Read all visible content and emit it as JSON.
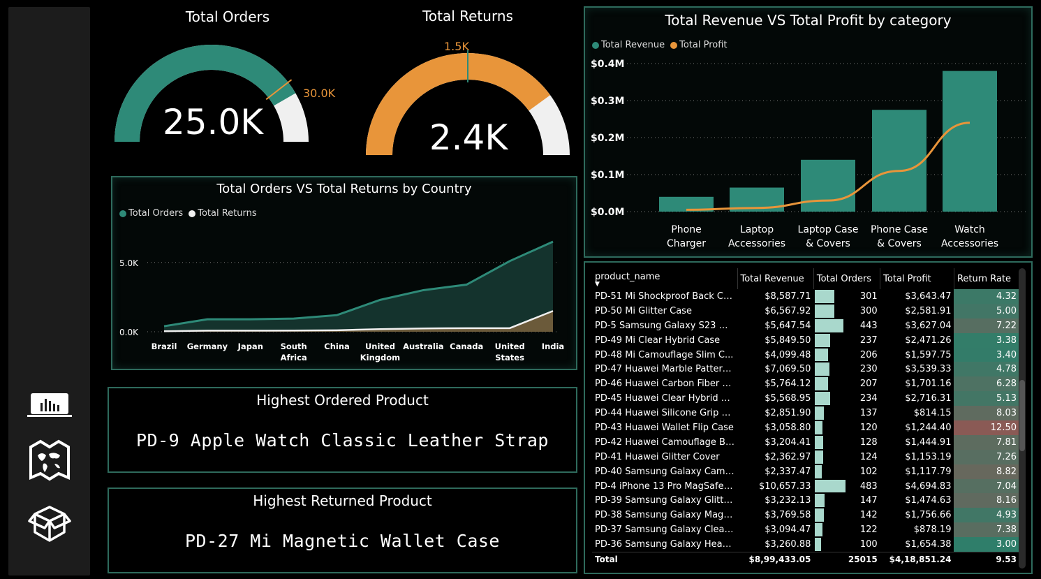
{
  "gauges": {
    "orders": {
      "title": "Total Orders",
      "value": "25.0K",
      "max_label": "30.0K",
      "fraction": 0.833
    },
    "returns": {
      "title": "Total Returns",
      "value": "2.4K",
      "target_label": "1.5K",
      "fraction": 0.8
    }
  },
  "country_chart": {
    "title": "Total Orders VS Total Returns by Country",
    "legend": [
      "Total Orders",
      "Total Returns"
    ]
  },
  "category_chart": {
    "title": "Total Revenue VS Total Profit by category",
    "legend": [
      "Total Revenue",
      "Total Profit"
    ]
  },
  "cards": {
    "highest_ordered": {
      "title": "Highest Ordered Product",
      "value": "PD-9  Apple Watch Classic Leather Strap"
    },
    "highest_returned": {
      "title": "Highest Returned Product",
      "value": "PD-27  Mi Magnetic Wallet Case"
    }
  },
  "table": {
    "headers": [
      "product_name",
      "Total Revenue",
      "Total Orders",
      "Total Profit",
      "Return Rate"
    ],
    "rows": [
      [
        "PD-51  Mi Shockproof Back Ca...",
        "$8,587.71",
        "301",
        "$3,643.47",
        "4.32"
      ],
      [
        "PD-50  Mi Glitter Case",
        "$6,567.92",
        "300",
        "$2,581.91",
        "5.00"
      ],
      [
        "PD-5  Samsung Galaxy S23 Ma...",
        "$5,647.54",
        "443",
        "$3,627.04",
        "7.22"
      ],
      [
        "PD-49  Mi Clear Hybrid Case",
        "$5,849.50",
        "237",
        "$2,471.26",
        "3.38"
      ],
      [
        "PD-48  Mi Camouflage Slim C...",
        "$4,099.48",
        "206",
        "$1,597.75",
        "3.40"
      ],
      [
        "PD-47  Huawei Marble Pattern...",
        "$7,069.50",
        "230",
        "$3,539.33",
        "4.78"
      ],
      [
        "PD-46  Huawei Carbon Fiber C...",
        "$5,764.12",
        "207",
        "$1,701.16",
        "6.28"
      ],
      [
        "PD-45  Huawei Clear Hybrid C...",
        "$5,568.95",
        "234",
        "$2,716.31",
        "5.13"
      ],
      [
        "PD-44  Huawei Silicone Grip C...",
        "$2,851.90",
        "137",
        "$814.15",
        "8.03"
      ],
      [
        "PD-43  Huawei Wallet Flip Case",
        "$3,058.80",
        "120",
        "$1,244.40",
        "12.50"
      ],
      [
        "PD-42  Huawei Camouflage Ba...",
        "$3,204.41",
        "128",
        "$1,444.91",
        "7.81"
      ],
      [
        "PD-41  Huawei Glitter Cover",
        "$2,362.97",
        "124",
        "$1,153.19",
        "7.26"
      ],
      [
        "PD-40  Samsung Galaxy Camo...",
        "$2,337.47",
        "102",
        "$1,117.79",
        "8.82"
      ],
      [
        "PD-4  iPhone 13 Pro MagSafe ...",
        "$10,657.33",
        "483",
        "$4,694.83",
        "7.04"
      ],
      [
        "PD-39  Samsung Galaxy Glitter...",
        "$3,232.13",
        "147",
        "$1,474.63",
        "8.16"
      ],
      [
        "PD-38  Samsung Galaxy Magn...",
        "$3,769.58",
        "142",
        "$1,756.66",
        "4.93"
      ],
      [
        "PD-37  Samsung Galaxy Clear ...",
        "$3,094.47",
        "122",
        "$878.19",
        "7.38"
      ],
      [
        "PD-36  Samsung Galaxy Heavy...",
        "$3,260.88",
        "100",
        "$1,654.38",
        "3.00"
      ]
    ],
    "total": [
      "Total",
      "$8,99,433.05",
      "25015",
      "$4,18,851.24",
      "9.53"
    ]
  },
  "colors": {
    "teal": "#2e8a78",
    "orange": "#e8953a",
    "light": "#f0f0f0",
    "rate_low": "#2f7e6a",
    "rate_high": "#8a5a55"
  },
  "chart_data": [
    {
      "type": "area",
      "title": "Total Orders VS Total Returns by Country",
      "categories": [
        "Brazil",
        "Germany",
        "Japan",
        "South Africa",
        "China",
        "United Kingdom",
        "Australia",
        "Canada",
        "United States",
        "India"
      ],
      "series": [
        {
          "name": "Total Orders",
          "values": [
            400,
            900,
            900,
            950,
            1200,
            2300,
            3000,
            3400,
            5100,
            6500
          ]
        },
        {
          "name": "Total Returns",
          "values": [
            40,
            80,
            80,
            90,
            110,
            190,
            240,
            260,
            260,
            1500
          ]
        }
      ],
      "yticks": [
        "0.0K",
        "5.0K"
      ],
      "ylim": [
        0,
        6500
      ],
      "legend": "top-left"
    },
    {
      "type": "bar",
      "title": "Total Revenue VS Total Profit by category",
      "categories": [
        "Phone Charger",
        "Laptop Accessories",
        "Laptop Case & Covers",
        "Phone Case & Covers",
        "Watch Accessories"
      ],
      "series": [
        {
          "name": "Total Revenue",
          "values": [
            0.04,
            0.065,
            0.14,
            0.275,
            0.38
          ]
        },
        {
          "name": "Total Profit",
          "values": [
            0.005,
            0.01,
            0.03,
            0.11,
            0.24
          ]
        }
      ],
      "yticks": [
        "$0.0M",
        "$0.1M",
        "$0.2M",
        "$0.3M",
        "$0.4M"
      ],
      "ylim": [
        0,
        0.4
      ],
      "legend": "top-left"
    }
  ]
}
